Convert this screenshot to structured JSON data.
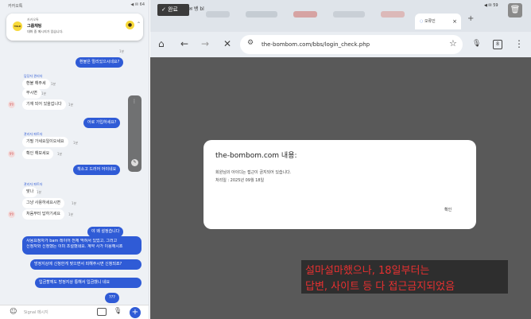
{
  "left": {
    "status": {
      "app": "카카오톡",
      "right": "◀ ✉ 64"
    },
    "notification": {
      "app": "카카오톡",
      "title": "그룹채팅",
      "body": "대화 중 메시지가 있습니다.",
      "logo": "TALK"
    },
    "bubbles": [
      {
        "text": "환불은 멀리있으시네요?",
        "time": "1분"
      },
      {
        "name": "담당자 관리자",
        "text": "환불 해주세",
        "time": "1분"
      },
      {
        "text": "부시면",
        "time": "1분"
      },
      {
        "text": "기재 되어 있을겁니다",
        "time": "1분"
      },
      {
        "text": "어로 가입하세요?",
        "time": "1분"
      },
      {
        "name": "관리자 파트자",
        "text": "기필 가세요일이오세요",
        "time": "1분"
      },
      {
        "text": "확인 해보세요",
        "time": "1분"
      },
      {
        "text": "책소고 드러어 어이네요",
        "time": "1분"
      },
      {
        "name": "관리자 파트자",
        "text": "맞나",
        "time": "1분"
      },
      {
        "text": "그냥 사용하세요시면",
        "time": "1분"
      },
      {
        "text": "처음부터 답하기세요",
        "time": "1분"
      },
      {
        "text": "야 왜 설정습니다",
        "time": "1분"
      },
      {
        "text": "사용요청자가 bam 레이어 전체 막혀서 있었고, 그러고",
        "text2": "신청자와 신청했는 이미 조절했네요. 계약 사가 이용해시죠",
        "time": "1분"
      },
      {
        "text": "방정지상에 신청한게 맞으면서 피해주시면 신청되죠?",
        "time": "1분"
      },
      {
        "text": "입금할께도 방정지상 통해서 입금했니 네요",
        "time": "1분"
      },
      {
        "text": "???",
        "time": "1분"
      }
    ],
    "avatars": [
      "담당",
      "담당",
      "담당"
    ],
    "input_placeholder": "Signal 메시지"
  },
  "right": {
    "toolbar": {
      "done_label": "✓ 완료",
      "clock": "14:31",
      "sys_icons": "✉ 뱅 bl",
      "tab_label": "오류인",
      "battery": "◀ ✉ 59",
      "trash": "🗑"
    },
    "nav": {
      "home": "⌂",
      "back": "←",
      "forward": "→",
      "stop": "✕",
      "url": "the-bombom.com/bbs/login_check.php",
      "star": "☆",
      "mic": "🎙",
      "tabs": "8",
      "menu": "⋮"
    },
    "dialog": {
      "title": "the-bombom.com 내용:",
      "line1": "회원님의 아이디는 접근이 금지되어 있습니다.",
      "line2": "처리일 : 2025년 09월 18일",
      "ok": "확인"
    },
    "annotation": {
      "line1": "설마설마했으나, 18일부터는",
      "line2": "답변, 사이트 등 다 접근금지되었음"
    }
  },
  "colors": {
    "chat_bg": "#eef1f5",
    "my_bubble": "#2f5bd6",
    "overlay": "#595959",
    "annotation_red": "#e83030"
  }
}
